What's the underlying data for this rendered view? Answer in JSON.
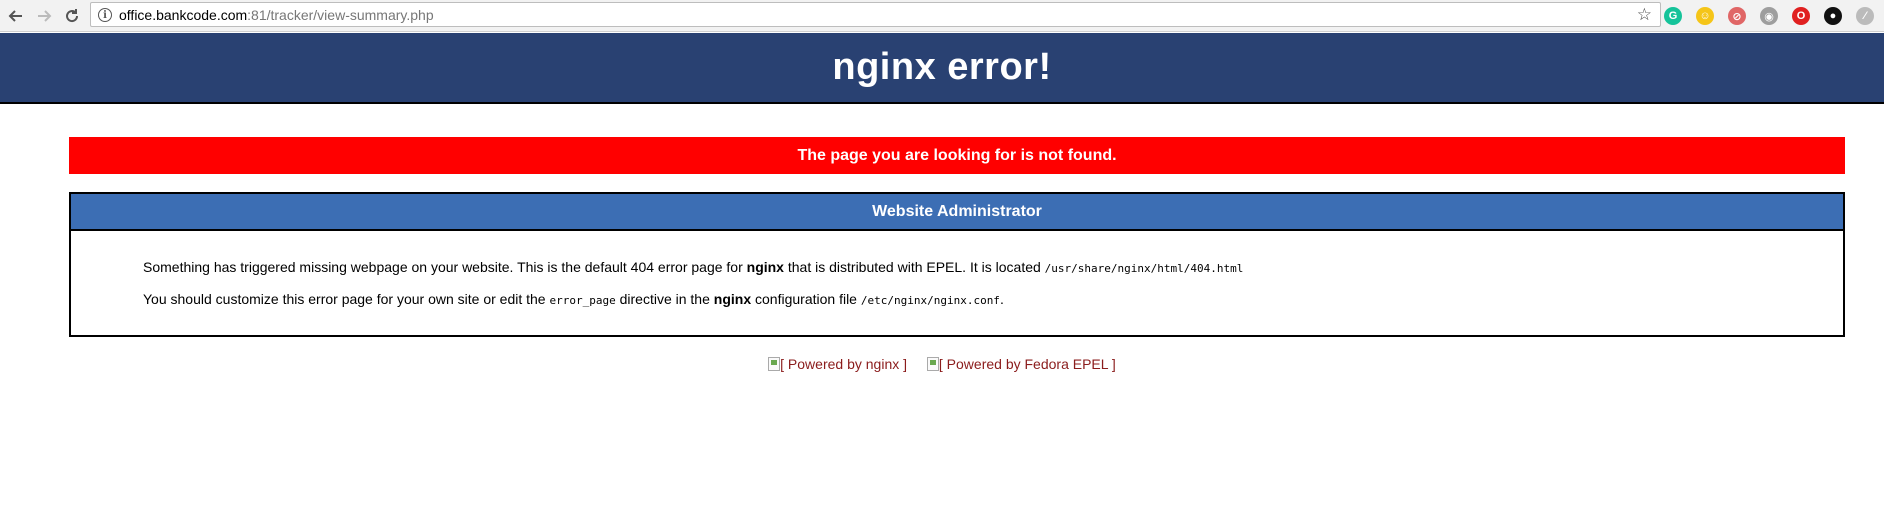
{
  "browser": {
    "url_host": "office.bankcode.com",
    "url_rest": ":81/tracker/view-summary.php",
    "extensions": [
      {
        "name": "grammarly-icon",
        "color": "#15c39a",
        "glyph": "G"
      },
      {
        "name": "emoji-icon",
        "color": "#f5c518",
        "glyph": "☺"
      },
      {
        "name": "blocker-icon",
        "color": "#e06666",
        "glyph": "⊘"
      },
      {
        "name": "camera-icon",
        "color": "#9e9e9e",
        "glyph": "◉"
      },
      {
        "name": "opera-icon",
        "color": "#e02020",
        "glyph": "O"
      },
      {
        "name": "eye-icon",
        "color": "#111111",
        "glyph": "●"
      },
      {
        "name": "feather-icon",
        "color": "#bbbbbb",
        "glyph": "⁄"
      }
    ]
  },
  "header": {
    "title": "nginx error!"
  },
  "alert": {
    "text": "The page you are looking for is not found."
  },
  "content": {
    "title": "Website Administrator",
    "line1": {
      "part1": "Something has triggered missing webpage on your website. This is the default 404 error page for ",
      "bold": "nginx",
      "part2": " that is distributed with EPEL. It is located ",
      "code": "/usr/share/nginx/html/404.html"
    },
    "line2": {
      "part1": "You should customize this error page for your own site or edit the ",
      "code1": "error_page",
      "part2": " directive in the ",
      "bold": "nginx",
      "part3": " configuration file ",
      "code2": "/etc/nginx/nginx.conf",
      "part4": "."
    }
  },
  "footer": {
    "link1": "[ Powered by nginx ]",
    "link2": "[ Powered by Fedora EPEL ]"
  },
  "colors": {
    "header_bg": "#294172",
    "alert_bg": "#ff0000",
    "content_title_bg": "#3c6eb4",
    "link": "#8b1c1c"
  }
}
